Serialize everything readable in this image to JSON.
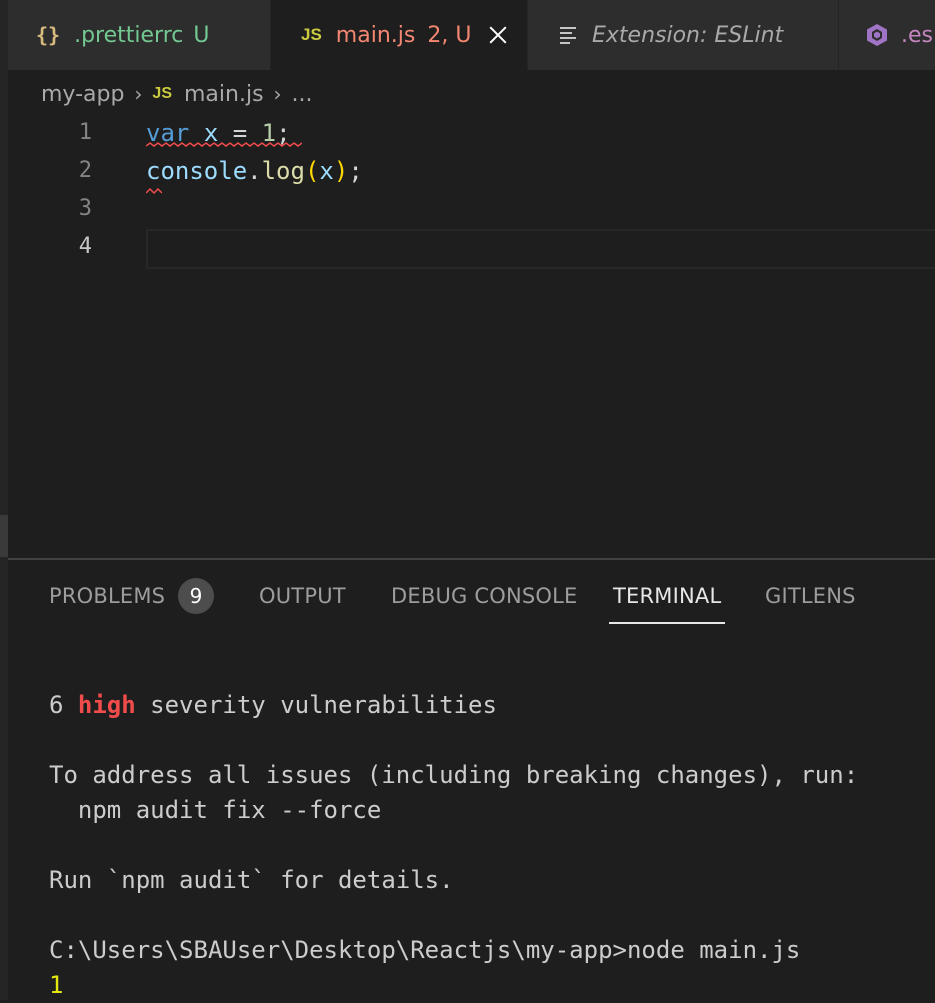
{
  "tabs": [
    {
      "icon": "braces-icon",
      "icon_text": "{}",
      "name": ".prettierrc",
      "status": "U"
    },
    {
      "icon": "js-icon",
      "icon_text": "JS",
      "name": "main.js",
      "status": "2, U"
    },
    {
      "icon": "lines-icon",
      "name": "Extension: ESLint"
    },
    {
      "icon": "eslint-hex-icon",
      "name": ".es"
    }
  ],
  "breadcrumb": {
    "folder": "my-app",
    "file_icon": "JS",
    "file": "main.js",
    "more": "..."
  },
  "editor": {
    "line_numbers": [
      "1",
      "2",
      "3",
      "4"
    ],
    "line1": {
      "kw": "var",
      "sp1": " ",
      "id": "x",
      "op": " = ",
      "num": "1",
      "end": ";"
    },
    "line2": {
      "obj": "console",
      "dot": ".",
      "fn": "log",
      "lp": "(",
      "arg": "x",
      "rp": ")",
      "end": ";"
    }
  },
  "panel": {
    "tabs": {
      "problems": "PROBLEMS",
      "output": "OUTPUT",
      "debug": "DEBUG CONSOLE",
      "terminal": "TERMINAL",
      "gitlens": "GITLENS"
    },
    "problems_count": "9",
    "terminal": {
      "l1a": "6 ",
      "l1b": "high",
      "l1c": " severity vulnerabilities",
      "l2": "To address all issues (including breaking changes), run:",
      "l3": "  npm audit fix --force",
      "l4": "Run `npm audit` for details.",
      "l5": "C:\\Users\\SBAUser\\Desktop\\Reactjs\\my-app>node main.js",
      "l6": "1"
    }
  },
  "colors": {
    "accent_red": "#f48771",
    "git_untracked": "#73c991",
    "error": "#f14c4c",
    "js_yellow": "#cbcb41"
  }
}
